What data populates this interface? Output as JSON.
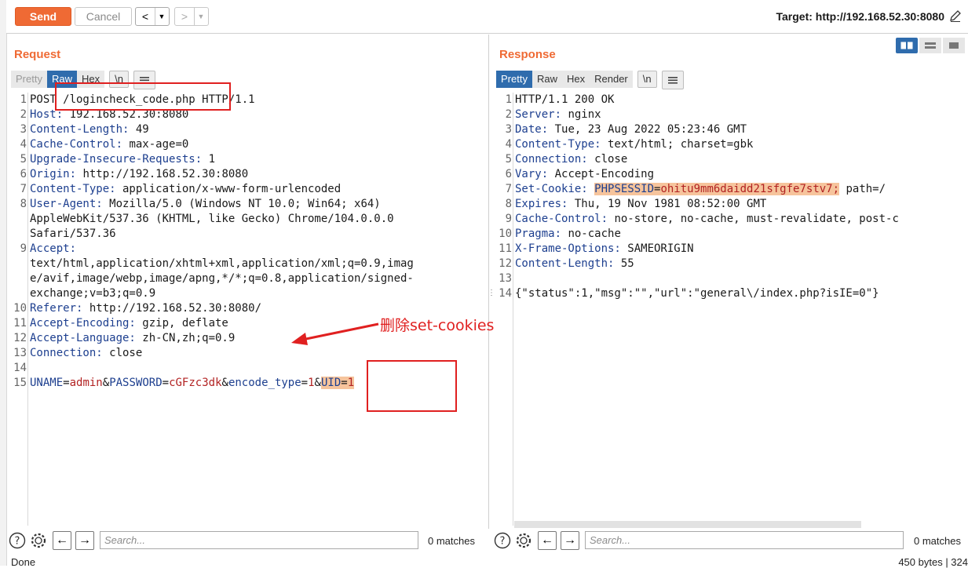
{
  "toolbar": {
    "send_label": "Send",
    "cancel_label": "Cancel",
    "back_label": "<",
    "forward_label": ">",
    "dropdown_glyph": "▼",
    "target": "Target: http://192.168.52.30:8080"
  },
  "request": {
    "title": "Request",
    "tabs": [
      "Pretty",
      "Raw",
      "Hex",
      "\\n"
    ],
    "lines": [
      {
        "n": "1",
        "k": "",
        "v": "POST /logincheck_code.php HTTP/1.1"
      },
      {
        "n": "2",
        "k": "Host:",
        "v": " 192.168.52.30:8080"
      },
      {
        "n": "3",
        "k": "Content-Length:",
        "v": " 49"
      },
      {
        "n": "4",
        "k": "Cache-Control:",
        "v": " max-age=0"
      },
      {
        "n": "5",
        "k": "Upgrade-Insecure-Requests:",
        "v": " 1"
      },
      {
        "n": "6",
        "k": "Origin:",
        "v": " http://192.168.52.30:8080"
      },
      {
        "n": "7",
        "k": "Content-Type:",
        "v": " application/x-www-form-urlencoded"
      },
      {
        "n": "8",
        "k": "User-Agent:",
        "v": " Mozilla/5.0 (Windows NT 10.0; Win64; x64)"
      },
      {
        "n": "",
        "k": "",
        "v": "AppleWebKit/537.36 (KHTML, like Gecko) Chrome/104.0.0.0"
      },
      {
        "n": "",
        "k": "",
        "v": "Safari/537.36"
      },
      {
        "n": "9",
        "k": "Accept:",
        "v": ""
      },
      {
        "n": "",
        "k": "",
        "v": "text/html,application/xhtml+xml,application/xml;q=0.9,imag"
      },
      {
        "n": "",
        "k": "",
        "v": "e/avif,image/webp,image/apng,*/*;q=0.8,application/signed-"
      },
      {
        "n": "",
        "k": "",
        "v": "exchange;v=b3;q=0.9"
      },
      {
        "n": "10",
        "k": "Referer:",
        "v": " http://192.168.52.30:8080/"
      },
      {
        "n": "11",
        "k": "Accept-Encoding:",
        "v": " gzip, deflate"
      },
      {
        "n": "12",
        "k": "Accept-Language:",
        "v": " zh-CN,zh;q=0.9"
      },
      {
        "n": "13",
        "k": "Connection:",
        "v": " close"
      },
      {
        "n": "14",
        "k": "",
        "v": ""
      }
    ],
    "body_line": {
      "n": "15",
      "parts": [
        "UNAME",
        "=",
        "admin",
        "&",
        "PASSWORD",
        "=",
        "cGFzc3dk",
        "&",
        "encode_type",
        "=",
        "1",
        "&",
        "UID",
        "=",
        "1"
      ]
    }
  },
  "response": {
    "title": "Response",
    "tabs": [
      "Pretty",
      "Raw",
      "Hex",
      "Render",
      "\\n"
    ],
    "lines": [
      {
        "n": "1",
        "k": "",
        "v": "HTTP/1.1 200 OK"
      },
      {
        "n": "2",
        "k": "Server:",
        "v": " nginx"
      },
      {
        "n": "3",
        "k": "Date:",
        "v": " Tue, 23 Aug 2022 05:23:46 GMT"
      },
      {
        "n": "4",
        "k": "Content-Type:",
        "v": " text/html; charset=gbk"
      },
      {
        "n": "5",
        "k": "Connection:",
        "v": " close"
      },
      {
        "n": "6",
        "k": "Vary:",
        "v": " Accept-Encoding"
      },
      {
        "n": "7",
        "k": "Set-Cookie:",
        "v": ""
      },
      {
        "n": "8",
        "k": "Expires:",
        "v": " Thu, 19 Nov 1981 08:52:00 GMT"
      },
      {
        "n": "9",
        "k": "Cache-Control:",
        "v": " no-store, no-cache, must-revalidate, post-c"
      },
      {
        "n": "10",
        "k": "Pragma:",
        "v": " no-cache"
      },
      {
        "n": "11",
        "k": "X-Frame-Options:",
        "v": " SAMEORIGIN"
      },
      {
        "n": "12",
        "k": "Content-Length:",
        "v": " 55"
      },
      {
        "n": "13",
        "k": "",
        "v": ""
      },
      {
        "n": "14",
        "k": "",
        "v": "{\"status\":1,\"msg\":\"\",\"url\":\"general\\/index.php?isIE=0\"}"
      }
    ],
    "cookie_name": "PHPSESSID",
    "cookie_eq": "=",
    "cookie_value": "ohitu9mm6daidd21sfgfe7stv7;",
    "cookie_rest": " path=/"
  },
  "search": {
    "placeholder": "Search...",
    "req_matches": "0 matches",
    "res_matches": "0 matches"
  },
  "status": {
    "left": "Done",
    "right": "450 bytes | 324"
  },
  "annotation": "删除set-cookies",
  "colors": {
    "accent": "#ef6a34",
    "tab_active": "#2f6cad",
    "annotation": "#e02020",
    "highlight": "#f6c49c"
  }
}
